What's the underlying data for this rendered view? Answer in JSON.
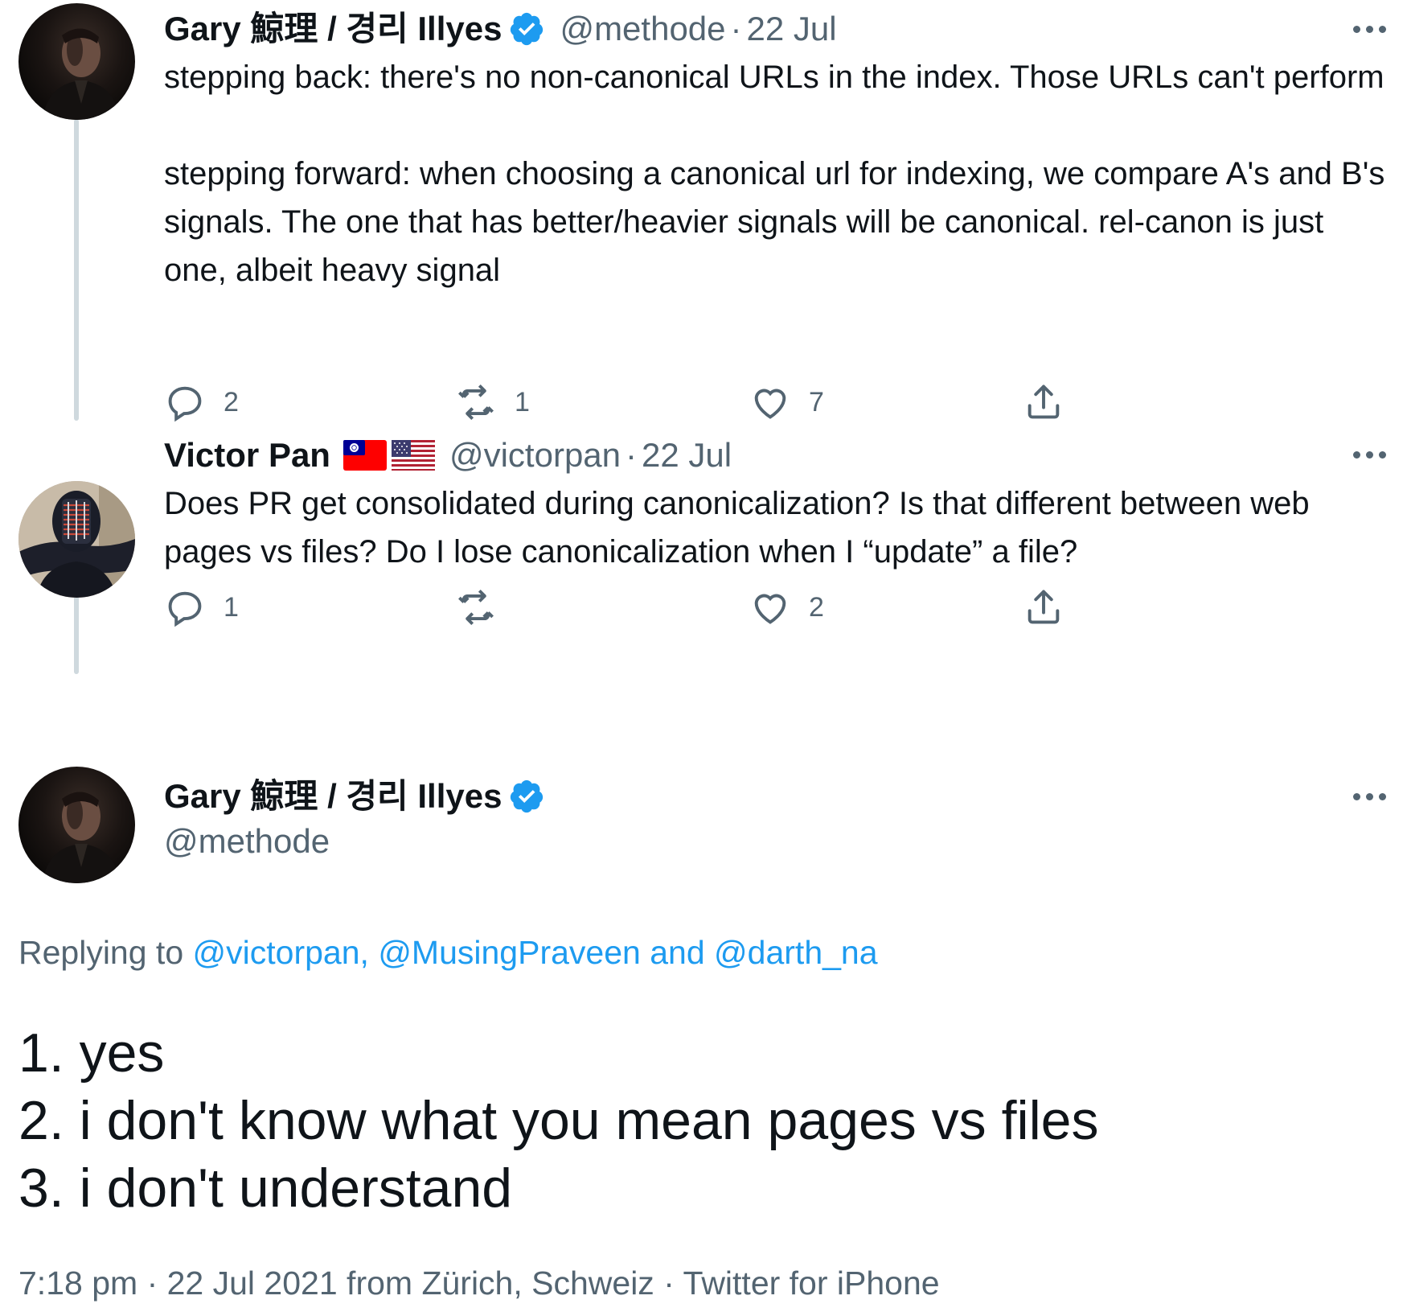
{
  "tweets": [
    {
      "name": "Gary 鯨理 / 경리 Illyes",
      "handle": "@methode",
      "separator": "·",
      "date": "22 Jul",
      "text": "stepping back: there's no non-canonical URLs in the index. Those URLs can't perform\n\nstepping forward: when choosing a canonical url for indexing, we compare A's and B's signals. The one that has better/heavier signals will be canonical. rel-canon is just one, albeit heavy signal",
      "replies": "2",
      "retweets": "1",
      "likes": "7"
    },
    {
      "name": "Victor Pan",
      "flags": [
        "taiwan-flag",
        "us-flag"
      ],
      "handle": "@victorpan",
      "separator": "·",
      "date": "22 Jul",
      "text": "Does PR get consolidated during canonicalization? Is that different between web pages vs files? Do I lose canonicalization when I “update” a file?",
      "replies": "1",
      "retweets": "",
      "likes": "2"
    }
  ],
  "main_tweet": {
    "name": "Gary 鯨理 / 경리 Illyes",
    "handle": "@methode",
    "replying_prefix": "Replying to ",
    "mention_1": "@victorpan",
    "comma": ",",
    "mention_2": "@MusingPraveen",
    "and_label": "and",
    "mention_3": "@darth_na",
    "lines": [
      "1. yes",
      "2. i don't know what you mean pages vs files",
      "3. i don't understand"
    ],
    "time": "7:18 pm",
    "date": "22 Jul 2021",
    "location": "from Zürich, Schweiz",
    "separator": "·",
    "source": "Twitter for iPhone"
  },
  "colors": {
    "accent": "#1d9bf0",
    "secondary_text": "#536471",
    "primary_text": "#0f1419",
    "thread_line": "#cfd9de"
  },
  "icons": [
    "reply-icon",
    "retweet-icon",
    "like-icon",
    "share-icon",
    "verified-badge-icon",
    "more-options-icon"
  ]
}
